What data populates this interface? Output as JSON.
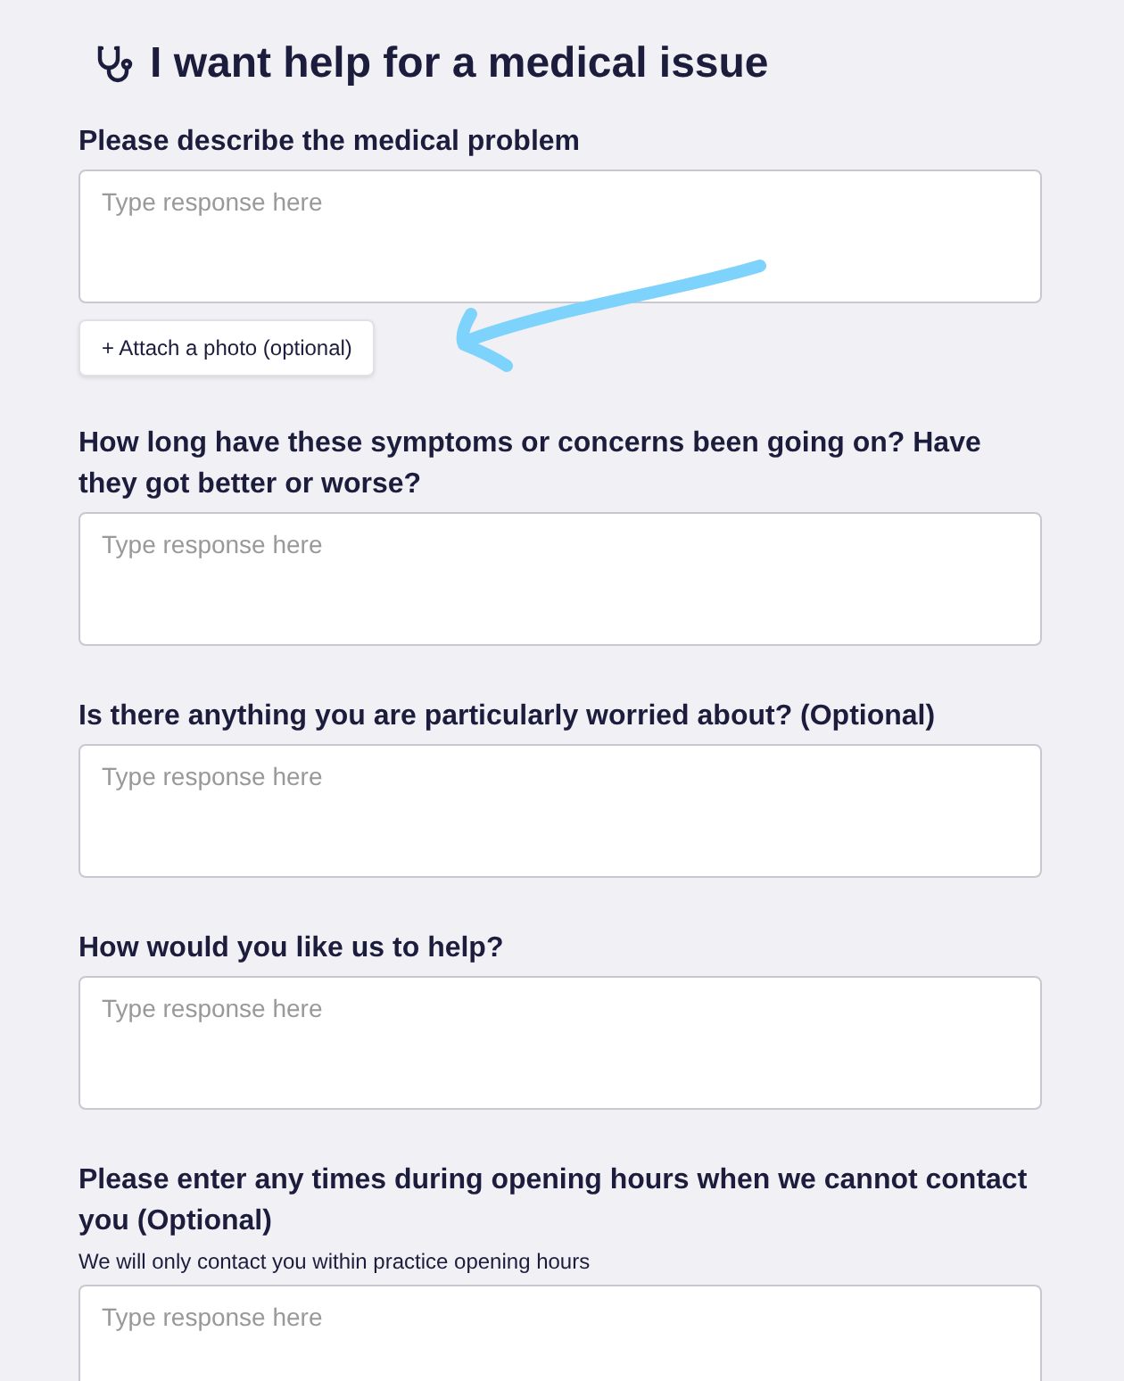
{
  "title": "I want help for a medical issue",
  "questions": [
    {
      "label": "Please describe the medical problem",
      "placeholder": "Type response here",
      "attach_button": "+ Attach a photo (optional)"
    },
    {
      "label": "How long have these symptoms or concerns been going on? Have they got better or worse?",
      "placeholder": "Type response here"
    },
    {
      "label": "Is there anything you are particularly worried about? (Optional)",
      "placeholder": "Type response here"
    },
    {
      "label": "How would you like us to help?",
      "placeholder": "Type response here"
    },
    {
      "label": "Please enter any times during opening hours when we cannot contact you (Optional)",
      "hint": "We will only contact you within practice opening hours",
      "placeholder": "Type response here"
    }
  ]
}
